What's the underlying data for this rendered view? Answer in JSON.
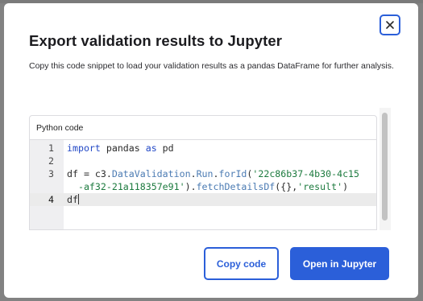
{
  "dialog": {
    "title": "Export validation results to Jupyter",
    "description": "Copy this code snippet to load your validation results as a pandas DataFrame for further analysis.",
    "close_icon": "close-icon"
  },
  "code_panel": {
    "header": "Python code",
    "active_line": 4,
    "lines": [
      {
        "number": "1",
        "tokens": [
          {
            "t": "import",
            "c": "kw"
          },
          {
            "t": " pandas ",
            "c": "plain"
          },
          {
            "t": "as",
            "c": "kw"
          },
          {
            "t": " pd",
            "c": "plain"
          }
        ]
      },
      {
        "number": "2",
        "tokens": []
      },
      {
        "number": "3",
        "tokens": [
          {
            "t": "df = c3.",
            "c": "plain"
          },
          {
            "t": "DataValidation",
            "c": "fn"
          },
          {
            "t": ".",
            "c": "plain"
          },
          {
            "t": "Run",
            "c": "fn"
          },
          {
            "t": ".",
            "c": "plain"
          },
          {
            "t": "forId",
            "c": "fn"
          },
          {
            "t": "(",
            "c": "plain"
          },
          {
            "t": "'22c86b37-4b30-4c15",
            "c": "str"
          }
        ]
      },
      {
        "number": "",
        "tokens": [
          {
            "t": "  ",
            "c": "plain"
          },
          {
            "t": "-af32-21a118357e91'",
            "c": "str"
          },
          {
            "t": ").",
            "c": "plain"
          },
          {
            "t": "fetchDetailsDf",
            "c": "fn"
          },
          {
            "t": "({},",
            "c": "plain"
          },
          {
            "t": "'result'",
            "c": "str"
          },
          {
            "t": ")",
            "c": "plain"
          }
        ]
      },
      {
        "number": "4",
        "tokens": [
          {
            "t": "df",
            "c": "plain"
          }
        ]
      }
    ]
  },
  "actions": {
    "copy_label": "Copy code",
    "open_label": "Open in Jupyter"
  },
  "colors": {
    "accent": "#2b5fd9",
    "keyword": "#2349c6",
    "string": "#1c7a3e"
  }
}
